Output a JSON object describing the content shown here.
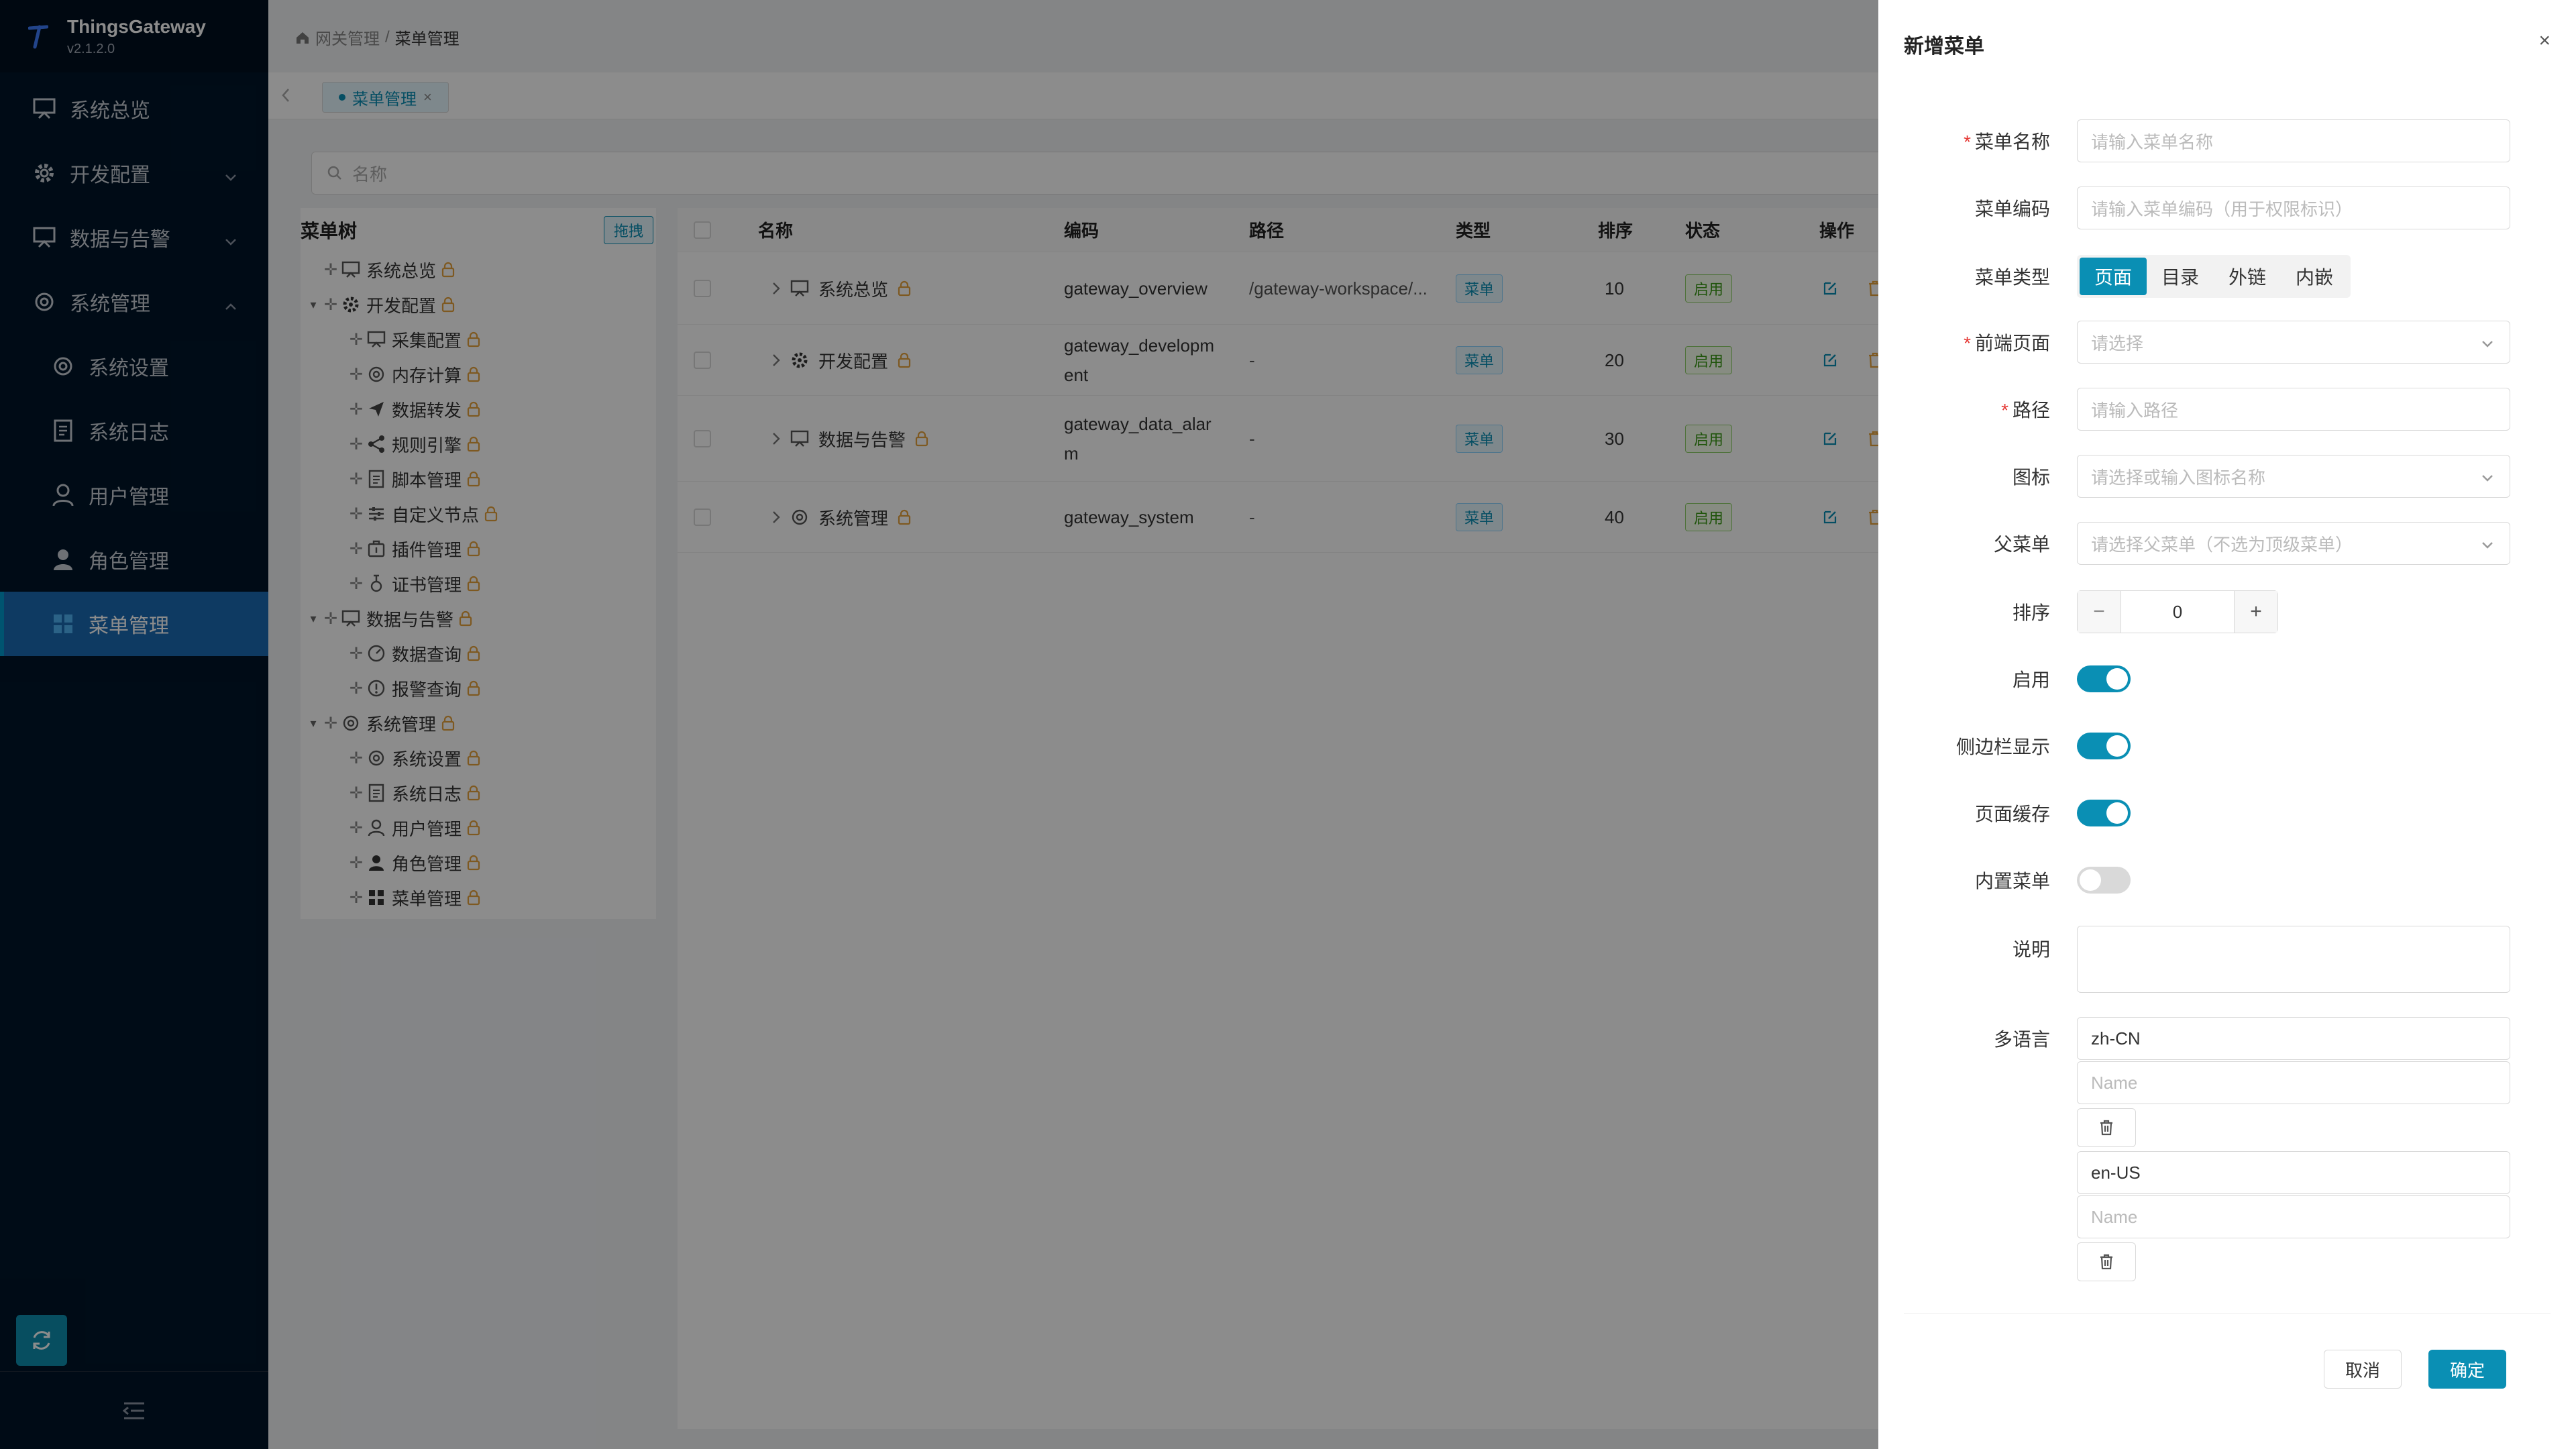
{
  "app": {
    "name": "ThingsGateway",
    "version": "v2.1.2.0"
  },
  "sidebar": {
    "items": [
      {
        "label": "系统总览",
        "icon": "monitor-icon"
      },
      {
        "label": "开发配置",
        "icon": "gear-icon"
      },
      {
        "label": "数据与告警",
        "icon": "monitor-icon"
      },
      {
        "label": "系统管理",
        "icon": "gear-icon"
      },
      {
        "label": "系统设置",
        "icon": "gear-icon"
      },
      {
        "label": "系统日志",
        "icon": "document-icon"
      },
      {
        "label": "用户管理",
        "icon": "user-icon"
      },
      {
        "label": "角色管理",
        "icon": "user-filled-icon"
      },
      {
        "label": "菜单管理",
        "icon": "grid-icon"
      }
    ]
  },
  "breadcrumb": {
    "root": "网关管理",
    "sep": "/",
    "current": "菜单管理"
  },
  "tabs": [
    {
      "label": "菜单管理"
    }
  ],
  "search": {
    "placeholder": "名称"
  },
  "tree": {
    "title": "菜单树",
    "drag_label": "拖拽",
    "rows": [
      {
        "label": "系统总览",
        "caret": ""
      },
      {
        "label": "开发配置",
        "caret": "▾"
      },
      {
        "label": "采集配置",
        "caret": ""
      },
      {
        "label": "内存计算",
        "caret": ""
      },
      {
        "label": "数据转发",
        "caret": ""
      },
      {
        "label": "规则引擎",
        "caret": ""
      },
      {
        "label": "脚本管理",
        "caret": ""
      },
      {
        "label": "自定义节点",
        "caret": ""
      },
      {
        "label": "插件管理",
        "caret": ""
      },
      {
        "label": "证书管理",
        "caret": ""
      },
      {
        "label": "数据与告警",
        "caret": "▾"
      },
      {
        "label": "数据查询",
        "caret": ""
      },
      {
        "label": "报警查询",
        "caret": ""
      },
      {
        "label": "系统管理",
        "caret": "▾"
      },
      {
        "label": "系统设置",
        "caret": ""
      },
      {
        "label": "系统日志",
        "caret": ""
      },
      {
        "label": "用户管理",
        "caret": ""
      },
      {
        "label": "角色管理",
        "caret": ""
      },
      {
        "label": "菜单管理",
        "caret": ""
      }
    ]
  },
  "table": {
    "headers": {
      "name": "名称",
      "code": "编码",
      "path": "路径",
      "type": "类型",
      "order": "排序",
      "status": "状态",
      "ops": "操作"
    },
    "rows": [
      {
        "name": "系统总览",
        "code1": "gateway_overview",
        "code2": "",
        "path": "/gateway-workspace/...",
        "type": "菜单",
        "order": "10",
        "status": "启用"
      },
      {
        "name": "开发配置",
        "code1": "gateway_developm",
        "code2": "ent",
        "path": "-",
        "type": "菜单",
        "order": "20",
        "status": "启用"
      },
      {
        "name": "数据与告警",
        "code1": "gateway_data_alar",
        "code2": "m",
        "path": "-",
        "type": "菜单",
        "order": "30",
        "status": "启用"
      },
      {
        "name": "系统管理",
        "code1": "gateway_system",
        "code2": "",
        "path": "-",
        "type": "菜单",
        "order": "40",
        "status": "启用"
      }
    ]
  },
  "drawer": {
    "title": "新增菜单",
    "close": "×",
    "labels": {
      "name": "菜单名称",
      "code": "菜单编码",
      "type": "菜单类型",
      "page": "前端页面",
      "path": "路径",
      "icon": "图标",
      "parent": "父菜单",
      "order": "排序",
      "enabled": "启用",
      "sidebar": "侧边栏显示",
      "cache": "页面缓存",
      "builtin": "内置菜单",
      "desc": "说明",
      "i18n": "多语言"
    },
    "placeholders": {
      "name": "请输入菜单名称",
      "code": "请输入菜单编码（用于权限标识）",
      "page": "请选择",
      "path": "请输入路径",
      "icon": "请选择或输入图标名称",
      "parent": "请选择父菜单（不选为顶级菜单）",
      "lang_name": "Name"
    },
    "type_options": [
      "页面",
      "目录",
      "外链",
      "内嵌"
    ],
    "type_selected": "页面",
    "order_value": "0",
    "stepper_minus": "−",
    "stepper_plus": "+",
    "toggles": {
      "enabled": true,
      "sidebar": true,
      "cache": true,
      "builtin": false
    },
    "languages": [
      "zh-CN",
      "en-US"
    ],
    "cancel": "取消",
    "ok": "确定"
  },
  "colors": {
    "accent": "#0a8fb4",
    "sidebar_bg": "#001529",
    "active_menu": "#1b6ab3",
    "required": "#e53935",
    "lock": "#e6a23c"
  }
}
